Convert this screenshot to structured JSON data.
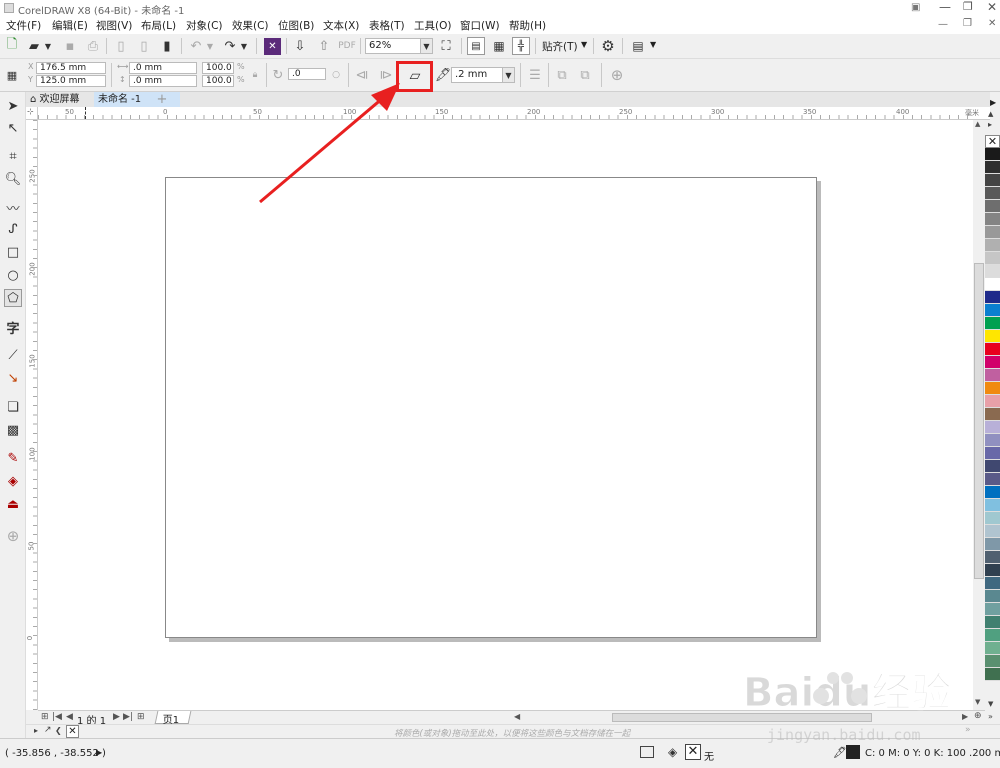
{
  "window": {
    "title": "CorelDRAW X8 (64-Bit) - 未命名 -1"
  },
  "menu": [
    "文件(F)",
    "编辑(E)",
    "视图(V)",
    "布局(L)",
    "对象(C)",
    "效果(C)",
    "位图(B)",
    "文本(X)",
    "表格(T)",
    "工具(O)",
    "窗口(W)",
    "帮助(H)"
  ],
  "toolbar": {
    "zoom": "62%",
    "snap_label": "贴齐(T)"
  },
  "property_bar": {
    "x": "176.5 mm",
    "y": "125.0 mm",
    "w": ".0 mm",
    "h": ".0 mm",
    "sx": "100.0",
    "sy": "100.0",
    "pct1": "%",
    "pct2": "%",
    "angle": ".0",
    "outline_width": ".2 mm"
  },
  "tabs": {
    "welcome": "欢迎屏幕",
    "doc": "未命名 -1"
  },
  "ruler": {
    "h_ticks": [
      "50",
      "0",
      "50",
      "100",
      "150",
      "200",
      "250",
      "300",
      "350",
      "400"
    ],
    "unit": "毫米",
    "v_ticks": [
      "250",
      "200",
      "150",
      "100",
      "50",
      "0"
    ]
  },
  "pagebar": {
    "counter": "1 的 1",
    "page_tab": "页1"
  },
  "docpalette": {
    "hint": "将颜色(或对象)拖动至此处，以便将这些颜色与文档存储在一起"
  },
  "status": {
    "coords": "( -35.856 , -38.552 )",
    "fill_none": "无",
    "outline_info": "C: 0 M: 0 Y: 0 K: 100  .200 mm"
  },
  "colors": {
    "accent": "#e82020",
    "palette": [
      "#1a1a1a",
      "#2e2e2e",
      "#444444",
      "#595959",
      "#6e6e6e",
      "#848484",
      "#999999",
      "#b0b0b0",
      "#c6c6c6",
      "#dcdcdc",
      "#ffffff",
      "#1e2a8a",
      "#0a7fd0",
      "#00a050",
      "#ffe600",
      "#e8001e",
      "#d1006a",
      "#c060a0",
      "#f08a10",
      "#e8a0a8",
      "#8a6a50",
      "#b8b0d8",
      "#9090c0",
      "#6868a8",
      "#404870",
      "#5a5a88",
      "#0070c0",
      "#80c0e0",
      "#a0c8d0",
      "#b0c4d0",
      "#7f98a8",
      "#506070",
      "#304050",
      "#406880",
      "#5a8890",
      "#70a0a0",
      "#408070",
      "#50a080",
      "#70b090",
      "#5a9070",
      "#407050"
    ]
  },
  "watermark": {
    "text1": "Baidu经验",
    "text2": "jingyan.baidu.com"
  }
}
